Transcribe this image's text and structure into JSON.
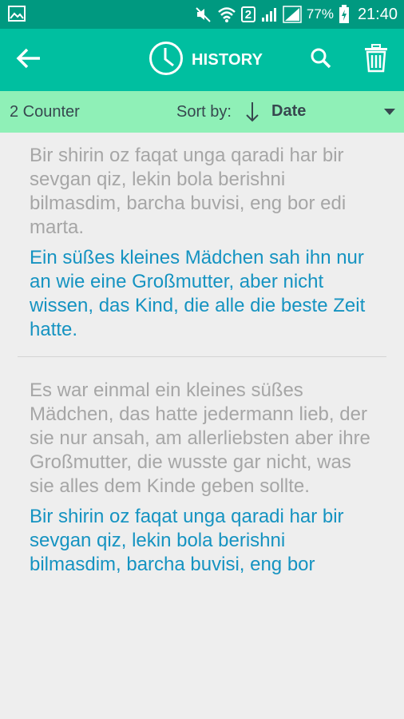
{
  "status_bar": {
    "battery_percent": "77%",
    "time": "21:40",
    "sim_badge": "2",
    "icons": [
      "gallery-icon",
      "mute-icon",
      "wifi-icon",
      "signal-icon",
      "signal-icon",
      "battery-charging-icon"
    ]
  },
  "app_bar": {
    "title": "HISTORY",
    "icons": [
      "back-arrow-icon",
      "clock-icon",
      "search-icon",
      "trash-icon"
    ]
  },
  "sub_bar": {
    "counter": "2 Counter",
    "sort_label": "Sort by:",
    "sort_value": "Date"
  },
  "items": [
    {
      "source": "Bir shirin oz faqat unga qaradi har bir sevgan qiz, lekin bola berishni bilmasdim, barcha buvisi, eng bor edi marta.",
      "translation": "Ein süßes kleines Mädchen sah ihn nur an wie eine Großmutter, aber nicht wissen, das Kind, die alle die beste Zeit hatte."
    },
    {
      "source": "Es war einmal ein kleines süßes Mädchen, das hatte jedermann lieb, der sie nur ansah, am allerliebsten aber ihre Großmutter, die wusste gar nicht, was sie alles dem Kinde geben sollte.",
      "translation": "Bir shirin oz faqat unga qaradi har bir sevgan qiz, lekin bola berishni bilmasdim, barcha buvisi, eng bor"
    }
  ],
  "colors": {
    "status_bar": "#009980",
    "app_bar": "#00bfa0",
    "sub_bar": "#8ff0b7",
    "source_text": "#a6a6a6",
    "translation_text": "#1593c1",
    "background": "#eeeeee"
  }
}
